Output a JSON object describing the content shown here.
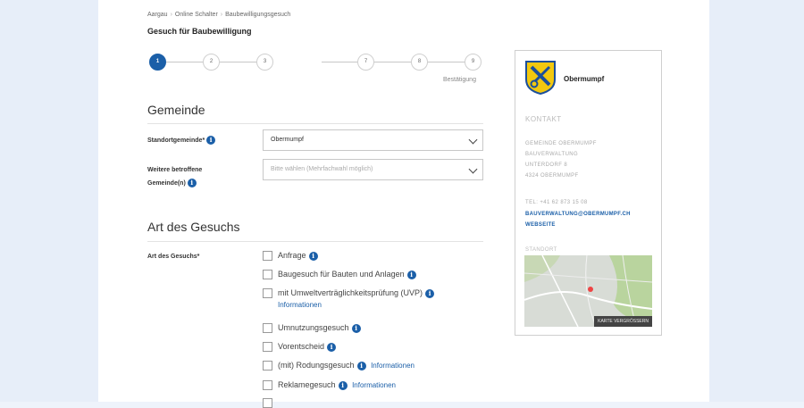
{
  "breadcrumb": [
    "Aargau",
    "Online Schalter",
    "Baubewilligungsgesuch"
  ],
  "page_title": "Gesuch für Baubewilligung",
  "steps": [
    "1",
    "2",
    "3",
    "7",
    "8",
    "9"
  ],
  "step_caption": "Bestätigung",
  "gemeinde": {
    "title": "Gemeinde",
    "standort_label": "Standortgemeinde*",
    "standort_value": "Obermumpf",
    "weitere_label_line1": "Weitere betroffene",
    "weitere_label_line2": "Gemeinde(n)",
    "weitere_placeholder": "Bitte wählen (Mehrfachwahl möglich)"
  },
  "art": {
    "title": "Art des Gesuchs",
    "label": "Art des Gesuchs*",
    "options": [
      {
        "label": "Anfrage",
        "info": true,
        "link": ""
      },
      {
        "label": "Baugesuch für Bauten und Anlagen",
        "info": true,
        "link": ""
      },
      {
        "label": "mit Umweltverträglichkeitsprüfung (UVP)",
        "info": true,
        "link": "Informationen"
      },
      {
        "label": "Umnutzungsgesuch",
        "info": true,
        "link": ""
      },
      {
        "label": "Vorentscheid",
        "info": true,
        "link": ""
      },
      {
        "label": "(mit) Rodungsgesuch",
        "info": true,
        "link": "Informationen"
      },
      {
        "label": "Reklamegesuch",
        "info": true,
        "link": "Informationen"
      }
    ]
  },
  "sidebar": {
    "org_name": "Obermumpf",
    "kontakt_heading": "KONTAKT",
    "address": [
      "GEMEINDE OBERMUMPF",
      "BAUVERWALTUNG",
      "UNTERDORF 8",
      "4324 OBERMUMPF"
    ],
    "phone": "TEL: +41 62 873 15 08",
    "email": "BAUVERWALTUNG@OBERMUMPF.CH",
    "website": "WEBSEITE",
    "standort_heading": "STANDORT",
    "map_button": "KARTE VERGRÖSSERN"
  },
  "colors": {
    "accent": "#1b5fa8",
    "crest_yellow": "#f2c80f",
    "crest_blue": "#1b4f9c"
  }
}
